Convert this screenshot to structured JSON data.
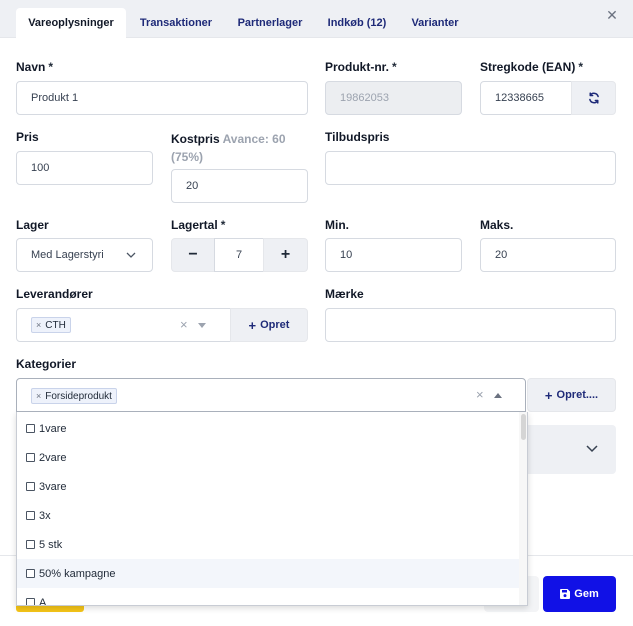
{
  "tabs": [
    {
      "label": "Vareoplysninger",
      "active": true
    },
    {
      "label": "Transaktioner"
    },
    {
      "label": "Partnerlager"
    },
    {
      "label": "Indkøb (12)"
    },
    {
      "label": "Varianter"
    }
  ],
  "fields": {
    "navn": {
      "label": "Navn",
      "required": "*",
      "value": "Produkt 1"
    },
    "produkt_nr": {
      "label": "Produkt-nr.",
      "required": "*",
      "value": "19862053"
    },
    "stregkode": {
      "label": "Stregkode (EAN)",
      "required": "*",
      "value": "12338665"
    },
    "pris": {
      "label": "Pris",
      "value": "100"
    },
    "kostpris": {
      "label": "Kostpris",
      "avance": "Avance: 60",
      "avance_pct": "(75%)",
      "value": "20"
    },
    "tilbudspris": {
      "label": "Tilbudspris",
      "value": ""
    },
    "lager": {
      "label": "Lager",
      "value": "Med Lagerstyri"
    },
    "lagertal": {
      "label": "Lagertal",
      "required": "*",
      "minus": "−",
      "value": "7",
      "plus": "+"
    },
    "min": {
      "label": "Min.",
      "value": "10"
    },
    "maks": {
      "label": "Maks.",
      "value": "20"
    },
    "leverandorer": {
      "label": "Leverandører",
      "tag": "CTH",
      "create": "Opret"
    },
    "maerke": {
      "label": "Mærke",
      "value": ""
    },
    "kategorier": {
      "label": "Kategorier",
      "tag": "Forsideprodukt",
      "create": "Opret...."
    }
  },
  "dropdown_options": [
    "1vare",
    "2vare",
    "3vare",
    "3x",
    "5 stk",
    "50% kampagne",
    "A"
  ],
  "footer": {
    "save_label": "Gem"
  },
  "colors": {
    "primary": "#1111e6",
    "tab_text": "#1e2a78",
    "accent_yellow": "#f5c518"
  }
}
